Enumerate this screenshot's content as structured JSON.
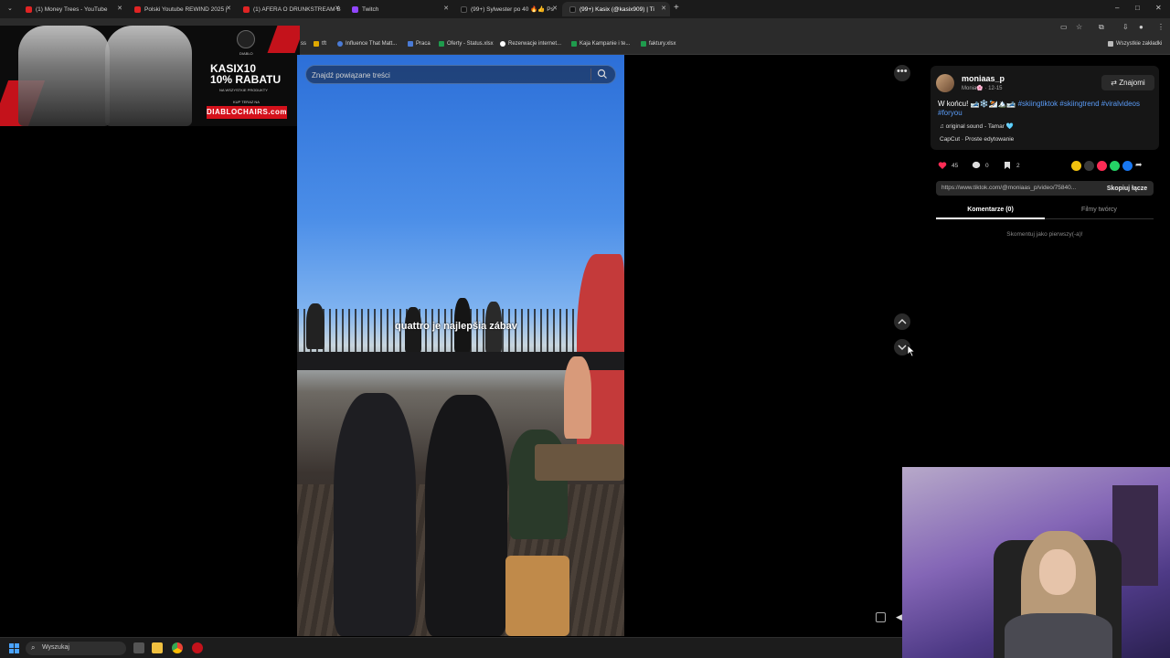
{
  "browser": {
    "tabs": [
      {
        "label": "(1) Money Trees - YouTube",
        "color": "#e02424"
      },
      {
        "label": "Polski Youtube REWIND 2025 |",
        "color": "#e02424"
      },
      {
        "label": "(1) AFERA O DRUNKSTREAM B",
        "color": "#e02424"
      },
      {
        "label": "Twitch",
        "color": "#9146ff"
      },
      {
        "label": "(99+) Sylwester po 40 🔥👍 Ps",
        "color": "#111111"
      },
      {
        "label": "(99+) Kasix (@kasix909) | Ti",
        "color": "#111111"
      }
    ],
    "new_tab": "+",
    "window_controls": [
      "–",
      "□",
      "✕"
    ],
    "bookmarks": [
      {
        "label": "ss",
        "color": "#888888"
      },
      {
        "label": "tft",
        "color": "#e0a800"
      },
      {
        "label": "Influence That Matt...",
        "color": "#4a7bd6"
      },
      {
        "label": "Praca",
        "color": "#4a7bd6"
      },
      {
        "label": "Oferty - Status.xlsx",
        "color": "#1f9b4d"
      },
      {
        "label": "Rezerwacje internet...",
        "color": "#ffffff"
      },
      {
        "label": "Kaja Kampanie i te...",
        "color": "#1f9b4d"
      },
      {
        "label": "faktury.xlsx",
        "color": "#1f9b4d"
      }
    ],
    "all_bookmarks": "Wszystkie zakładki"
  },
  "ad": {
    "code": "KASIX10",
    "promo": "10% RABATU",
    "small": "NA WSZYSTKIE PRODUKTY",
    "small2": "KUP TERAZ NA",
    "domain": "DIABLOCHAIRS.com",
    "brand": "DIABLO"
  },
  "search": {
    "placeholder": "Znajdź powiązane treści"
  },
  "video": {
    "caption": "quattro je najlepšia zábav"
  },
  "post": {
    "username": "moniaas_p",
    "display_name": "Monia🌸",
    "date": "12-15",
    "follow": "Znajomi",
    "desc_text": "W końcu! 🎿❄️⛷️🏔️🎿",
    "hashtags": "#skiingtiktok #skiingtrend #viralvideos #foryou",
    "sound": "♫ original sound - Tamar 🩵",
    "capcut": "CapCut · Proste edytowanie",
    "likes": "45",
    "comments": "0",
    "saves": "2",
    "url": "https://www.tiktok.com/@moniaas_p/video/75840...",
    "copy": "Skopiuj łącze",
    "tab_comments": "Komentarze (0)",
    "tab_creator": "Filmy twórcy",
    "first_comment": "Skomentuj jako pierwszy(-a)!"
  },
  "taskbar": {
    "search": "Wyszukaj"
  },
  "colors": {
    "like": "#fe2c55",
    "tag": "#5a9bf6"
  }
}
